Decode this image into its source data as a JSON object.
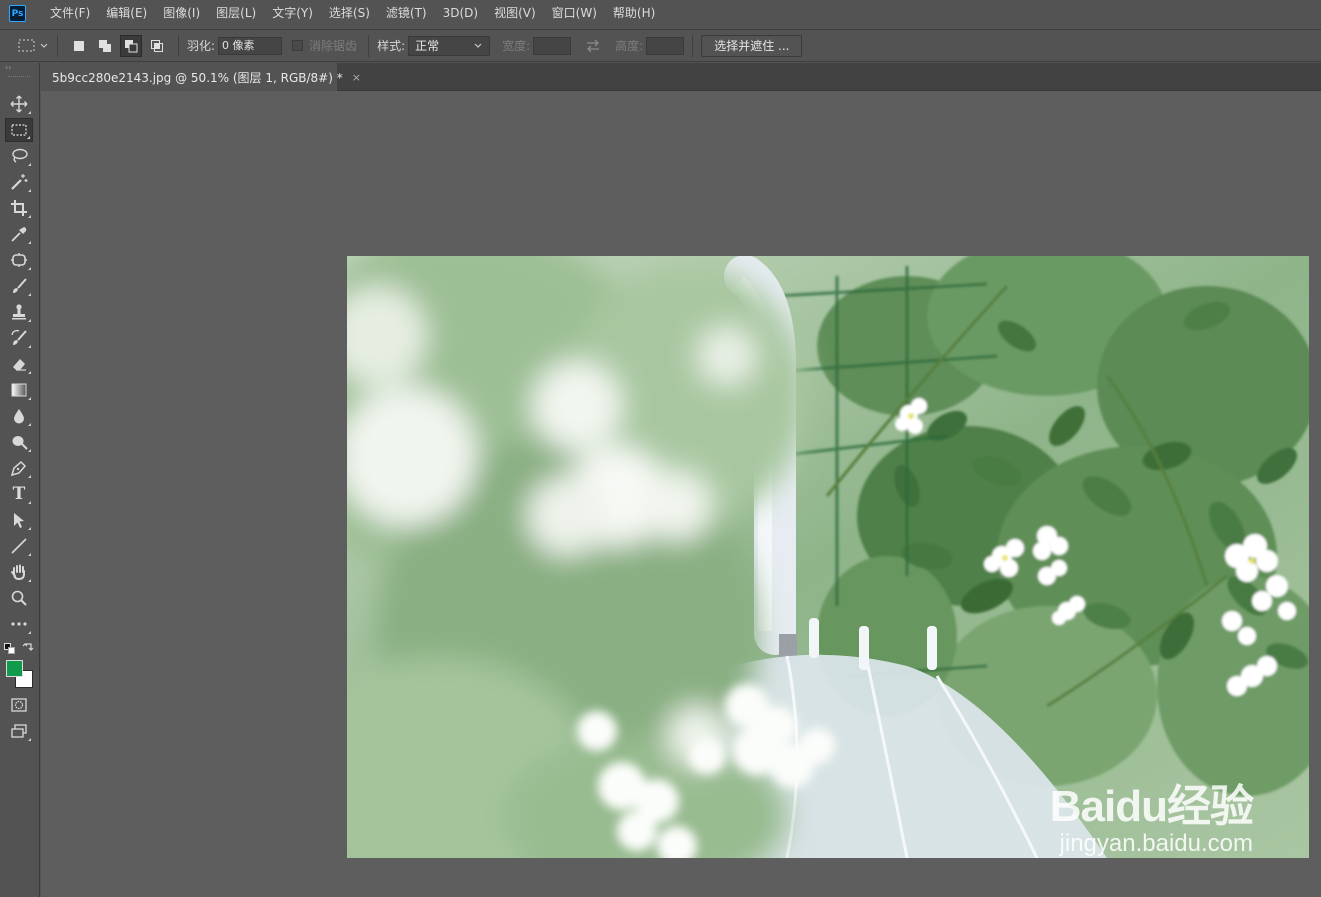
{
  "app": {
    "logo": "Ps"
  },
  "menu": [
    "文件(F)",
    "编辑(E)",
    "图像(I)",
    "图层(L)",
    "文字(Y)",
    "选择(S)",
    "滤镜(T)",
    "3D(D)",
    "视图(V)",
    "窗口(W)",
    "帮助(H)"
  ],
  "options": {
    "feather_label": "羽化:",
    "feather_value": "0 像素",
    "antialias_label": "消除锯齿",
    "style_label": "样式:",
    "style_value": "正常",
    "width_label": "宽度:",
    "height_label": "高度:",
    "select_mask_button": "选择并遮住 ..."
  },
  "document": {
    "tab_title": "5b9cc280e2143.jpg @ 50.1% (图层 1, RGB/8#) *",
    "close_glyph": "×"
  },
  "tools": [
    {
      "name": "move-tool",
      "icon": "move-icon"
    },
    {
      "name": "rect-marquee-tool",
      "icon": "rect-marquee-icon",
      "active": true
    },
    {
      "name": "lasso-tool",
      "icon": "lasso-icon"
    },
    {
      "name": "magic-wand-tool",
      "icon": "magic-wand-icon"
    },
    {
      "name": "crop-tool",
      "icon": "crop-icon"
    },
    {
      "name": "eyedropper-tool",
      "icon": "eyedropper-icon"
    },
    {
      "name": "patch-tool",
      "icon": "patch-icon"
    },
    {
      "name": "brush-tool",
      "icon": "brush-icon"
    },
    {
      "name": "stamp-tool",
      "icon": "stamp-icon"
    },
    {
      "name": "history-brush-tool",
      "icon": "history-brush-icon"
    },
    {
      "name": "eraser-tool",
      "icon": "eraser-icon"
    },
    {
      "name": "gradient-tool",
      "icon": "gradient-icon"
    },
    {
      "name": "blur-tool",
      "icon": "blur-drop-icon"
    },
    {
      "name": "dodge-tool",
      "icon": "dodge-icon"
    },
    {
      "name": "pen-tool",
      "icon": "pen-icon"
    },
    {
      "name": "type-tool",
      "icon": "type-icon"
    },
    {
      "name": "path-select-tool",
      "icon": "path-select-icon"
    },
    {
      "name": "line-tool",
      "icon": "line-icon"
    },
    {
      "name": "hand-tool",
      "icon": "hand-icon"
    },
    {
      "name": "zoom-tool",
      "icon": "zoom-icon"
    },
    {
      "name": "more-tools",
      "icon": "ellipsis-icon"
    }
  ],
  "colors": {
    "foreground": "#0f9a4e",
    "background": "#ffffff",
    "accent": "#31a8ff"
  },
  "type_tool_glyph": "T",
  "watermark": {
    "brand": "Baidu经验",
    "url": "jingyan.baidu.com"
  }
}
